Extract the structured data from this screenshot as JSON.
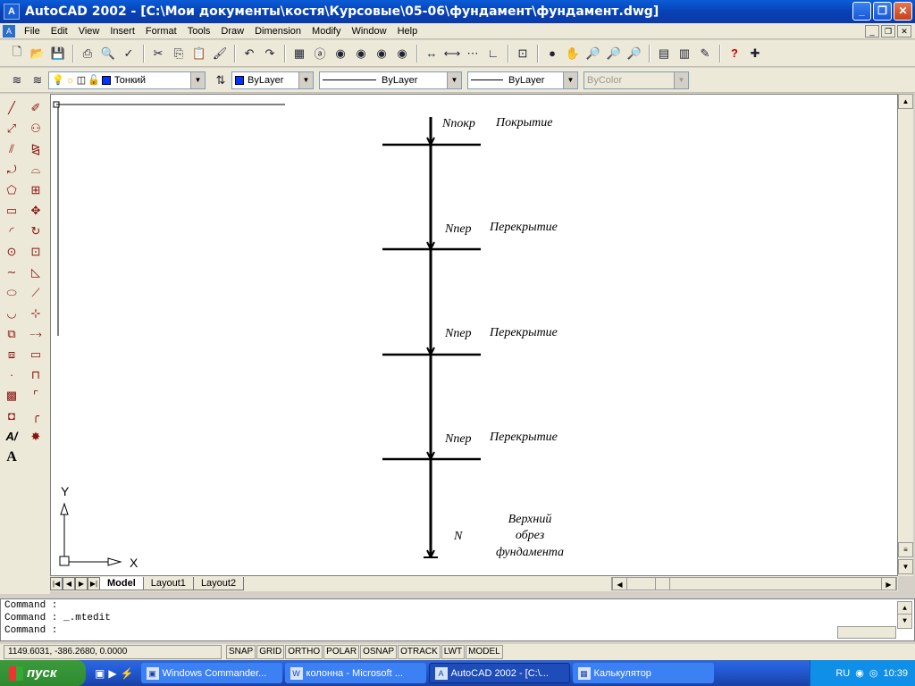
{
  "window": {
    "title": "AutoCAD 2002 - [C:\\Мои документы\\костя\\Курсовые\\05-06\\фундамент\\фундамент.dwg]",
    "icon_label": "A"
  },
  "menu": [
    "File",
    "Edit",
    "View",
    "Insert",
    "Format",
    "Tools",
    "Draw",
    "Dimension",
    "Modify",
    "Window",
    "Help"
  ],
  "toolbar2": {
    "layer": "Тонкий",
    "color": "ByLayer",
    "linetype": "ByLayer",
    "lineweight": "ByLayer",
    "plotstyle": "ByColor"
  },
  "drawing": {
    "levels": [
      {
        "load": "Nпокр",
        "name": "Покрытие"
      },
      {
        "load": "Nпер",
        "name": "Перекрытие"
      },
      {
        "load": "Nпер",
        "name": "Перекрытие"
      },
      {
        "load": "Nпер",
        "name": "Перекрытие"
      }
    ],
    "bottom": {
      "load": "N",
      "name_lines": [
        "Верхний",
        "обрез",
        "фундамента"
      ]
    },
    "ucs": {
      "x": "X",
      "y": "Y"
    }
  },
  "tabs": [
    "Model",
    "Layout1",
    "Layout2"
  ],
  "command_lines": [
    "Command :",
    "Command : _.mtedit",
    "Command :"
  ],
  "status": {
    "coords": "1149.6031, -386.2680, 0.0000",
    "toggles": [
      "SNAP",
      "GRID",
      "ORTHO",
      "POLAR",
      "OSNAP",
      "OTRACK",
      "LWT",
      "MODEL"
    ]
  },
  "taskbar": {
    "start_label": "пуск",
    "tasks": [
      {
        "label": "Windows Commander...",
        "icon": "floppy-icon"
      },
      {
        "label": "колонна - Microsoft ...",
        "icon": "word-icon"
      },
      {
        "label": "AutoCAD 2002 - [C:\\...",
        "icon": "autocad-icon"
      },
      {
        "label": "Калькулятор",
        "icon": "calculator-icon"
      }
    ],
    "lang": "RU",
    "clock": "10:39"
  }
}
